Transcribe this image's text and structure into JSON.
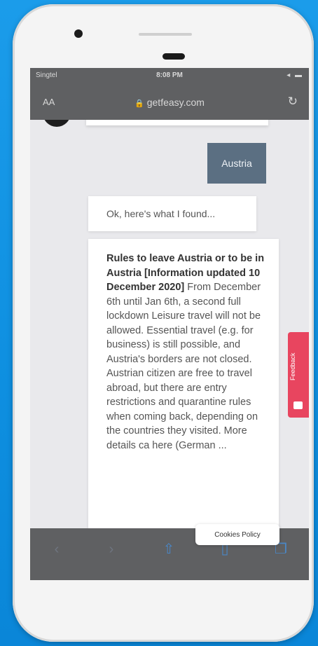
{
  "status_bar": {
    "carrier": "Singtel",
    "time": "8:08 PM",
    "right": "◂ ▬"
  },
  "browser": {
    "aa": "AA",
    "url": "getfeasy.com",
    "reload": "↻"
  },
  "chat": {
    "user_message": "Austria",
    "bot_intro": "Ok, here's what I found...",
    "info_heading": "Rules to leave Austria or to be in Austria [Information updated 10 December 2020]",
    "info_body": " From December 6th until Jan 6th, a second full lockdown Leisure travel will not be allowed. Essential travel (e.g. for business) is still possible, and Austria's borders are not closed. Austrian citizen are free to travel abroad, but there are entry restrictions and quarantine rules when coming back, depending on the countries they visited. More details ca here (German ..."
  },
  "feedback": {
    "label": "Feedback"
  },
  "cookies": {
    "label": "Cookies Policy"
  },
  "toolbar": {
    "icons": [
      "back-icon",
      "forward-icon",
      "share-icon",
      "bookmarks-icon",
      "tabs-icon"
    ]
  },
  "colors": {
    "accent": "#e8455f",
    "user_bubble": "#5b6f82",
    "toolbar": "#5f6062"
  }
}
